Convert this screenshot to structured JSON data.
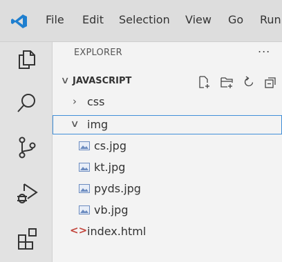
{
  "menu": [
    "File",
    "Edit",
    "Selection",
    "View",
    "Go",
    "Run"
  ],
  "activity": [
    "explorer-icon",
    "search-icon",
    "source-control-icon",
    "run-debug-icon",
    "extensions-icon"
  ],
  "explorer": {
    "title": "EXPLORER",
    "more": "...",
    "section_title": "JAVASCRIPT",
    "tree": [
      {
        "label": "css",
        "type": "folder",
        "expanded": false
      },
      {
        "label": "img",
        "type": "folder",
        "expanded": true,
        "selected": true
      },
      {
        "label": "cs.jpg",
        "type": "image"
      },
      {
        "label": "kt.jpg",
        "type": "image"
      },
      {
        "label": "pyds.jpg",
        "type": "image"
      },
      {
        "label": "vb.jpg",
        "type": "image"
      },
      {
        "label": "index.html",
        "type": "html"
      }
    ]
  },
  "colors": {
    "accent": "#3f8ed8",
    "logo": "#1f7fcf",
    "html_icon": "#c2433a",
    "image_icon": "#6b8bbf"
  }
}
